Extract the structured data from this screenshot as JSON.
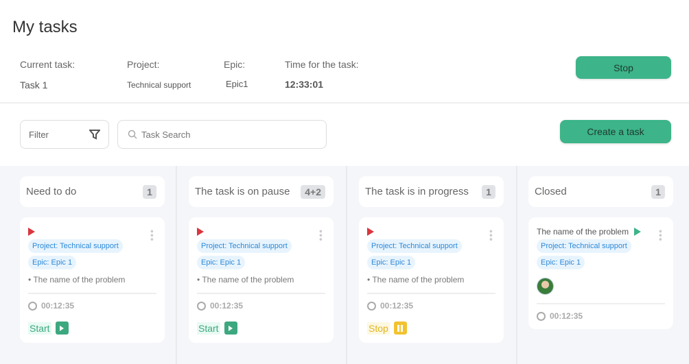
{
  "header": {
    "title": "My tasks",
    "current_task_label": "Current task:",
    "current_task": "Task 1",
    "project_label": "Project:",
    "project": "Technical support",
    "epic_label": "Epic:",
    "epic": "Epic1",
    "time_label": "Time for the task:",
    "time": "12:33:01",
    "stop_label": "Stop"
  },
  "toolbar": {
    "filter_label": "Filter",
    "search_placeholder": "Task Search",
    "create_label": "Create a task"
  },
  "colors": {
    "accent": "#3db489",
    "stop": "#f2c230",
    "flag": "#d9363e",
    "tag_bg": "#e8f4fd",
    "tag_text": "#2b88d8"
  },
  "columns": [
    {
      "title": "Need to do",
      "count": "1",
      "cards": [
        {
          "flag": "red",
          "project": "Project: Technical support",
          "epic": "Epic: Epic 1",
          "name": "• The name of the problem",
          "time": "00:12:35",
          "action": "Start",
          "action_icon": "play-icon"
        }
      ]
    },
    {
      "title": "The task is on pause",
      "count": "4+2",
      "cards": [
        {
          "flag": "red",
          "project": "Project: Technical support",
          "epic": "Epic: Epic 1",
          "name": "• The name of the problem",
          "time": "00:12:35",
          "action": "Start",
          "action_icon": "play-icon"
        }
      ]
    },
    {
      "title": "The task is in progress",
      "count": "1",
      "cards": [
        {
          "flag": "red",
          "project": "Project: Technical support",
          "epic": "Epic: Epic 1",
          "name": "• The name of the problem",
          "time": "00:12:35",
          "action": "Stop",
          "action_icon": "pause-icon"
        }
      ]
    },
    {
      "title": "Closed",
      "count": "1",
      "cards": [
        {
          "flag": "green",
          "title": "The name of the problem",
          "project": "Project: Technical support",
          "epic": "Epic: Epic 1",
          "avatar": true,
          "time": "00:12:35"
        }
      ]
    }
  ]
}
